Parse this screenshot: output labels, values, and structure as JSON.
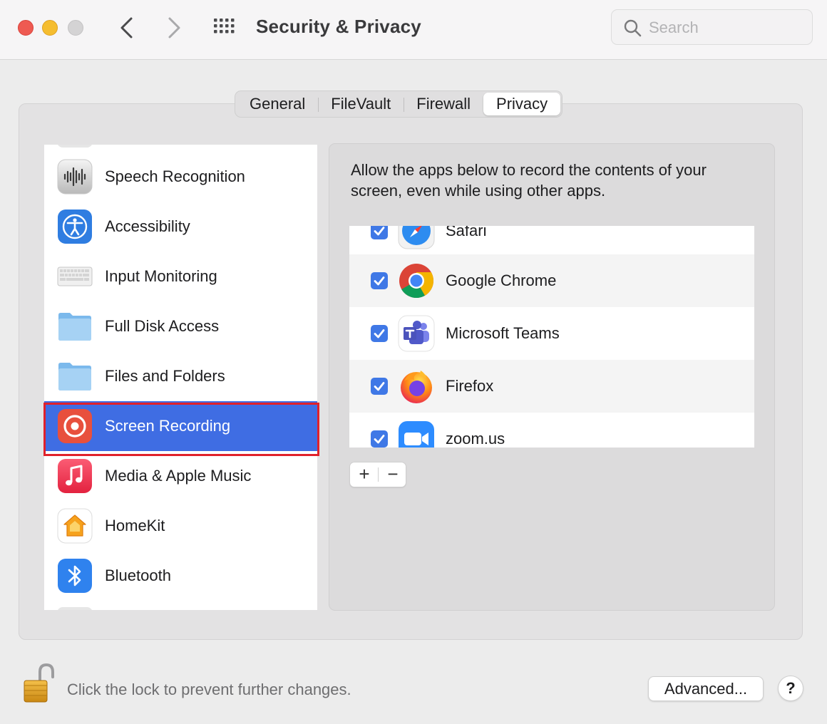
{
  "window": {
    "title": "Security & Privacy",
    "search_placeholder": "Search"
  },
  "toolbar": {
    "back_icon": "chevron-left-icon",
    "forward_icon": "chevron-right-icon",
    "grid_icon": "grid-icon"
  },
  "tabs": [
    {
      "label": "General",
      "selected": false
    },
    {
      "label": "FileVault",
      "selected": false
    },
    {
      "label": "Firewall",
      "selected": false
    },
    {
      "label": "Privacy",
      "selected": true
    }
  ],
  "categories": [
    {
      "label": "Speech Recognition",
      "icon": "speech-recognition-icon",
      "selected": false
    },
    {
      "label": "Accessibility",
      "icon": "accessibility-icon",
      "selected": false
    },
    {
      "label": "Input Monitoring",
      "icon": "keyboard-icon",
      "selected": false
    },
    {
      "label": "Full Disk Access",
      "icon": "folder-icon",
      "selected": false
    },
    {
      "label": "Files and Folders",
      "icon": "folder-icon",
      "selected": false
    },
    {
      "label": "Screen Recording",
      "icon": "screen-recording-icon",
      "selected": true
    },
    {
      "label": "Media & Apple Music",
      "icon": "music-icon",
      "selected": false
    },
    {
      "label": "HomeKit",
      "icon": "homekit-icon",
      "selected": false
    },
    {
      "label": "Bluetooth",
      "icon": "bluetooth-icon",
      "selected": false
    }
  ],
  "detail": {
    "description": "Allow the apps below to record the contents of your screen, even while using other apps.",
    "apps": [
      {
        "name": "Safari",
        "checked": true,
        "icon": "safari-icon"
      },
      {
        "name": "Google Chrome",
        "checked": true,
        "icon": "chrome-icon"
      },
      {
        "name": "Microsoft Teams",
        "checked": true,
        "icon": "teams-icon"
      },
      {
        "name": "Firefox",
        "checked": true,
        "icon": "firefox-icon"
      },
      {
        "name": "zoom.us",
        "checked": true,
        "icon": "zoom-icon"
      }
    ],
    "add_label": "+",
    "remove_label": "−"
  },
  "footer": {
    "lock_text": "Click the lock to prevent further changes.",
    "advanced_label": "Advanced...",
    "help_label": "?",
    "lock_icon": "unlocked-padlock-icon"
  },
  "colors": {
    "selection": "#3f6de3",
    "selection_outline": "#e0212b",
    "checkbox": "#3f78e6"
  }
}
